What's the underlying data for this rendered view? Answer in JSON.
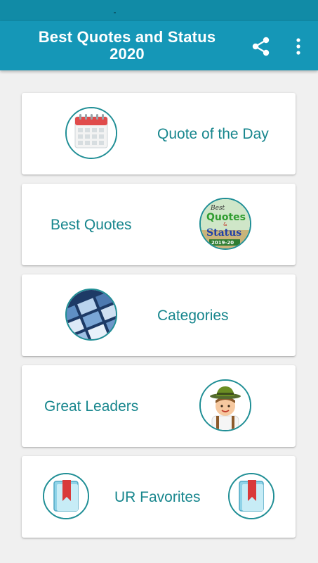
{
  "app": {
    "title": "Best Quotes and Status\n2020",
    "share_icon": "share-icon",
    "more_icon": "more-vertical-icon"
  },
  "menu": [
    {
      "id": "quote-of-the-day",
      "label": "Quote of the Day",
      "icon": "calendar-icon"
    },
    {
      "id": "best-quotes",
      "label": "Best Quotes",
      "icon": "best-quotes-logo-icon",
      "logo_text": {
        "line1": "Best",
        "line2": "Quotes",
        "amp": "&",
        "line3": "Status",
        "line4": "2019-20"
      }
    },
    {
      "id": "categories",
      "label": "Categories",
      "icon": "categories-photo-icon"
    },
    {
      "id": "great-leaders",
      "label": "Great Leaders",
      "icon": "leader-avatar-icon"
    },
    {
      "id": "ur-favorites",
      "label": "UR Favorites",
      "icon": "bookmark-book-icon"
    }
  ],
  "colors": {
    "app_bar": "#1597b7",
    "status_bar": "#118ba6",
    "label_text": "#17868d",
    "icon_ring": "#1f8e95",
    "background": "#f0f0f0"
  }
}
